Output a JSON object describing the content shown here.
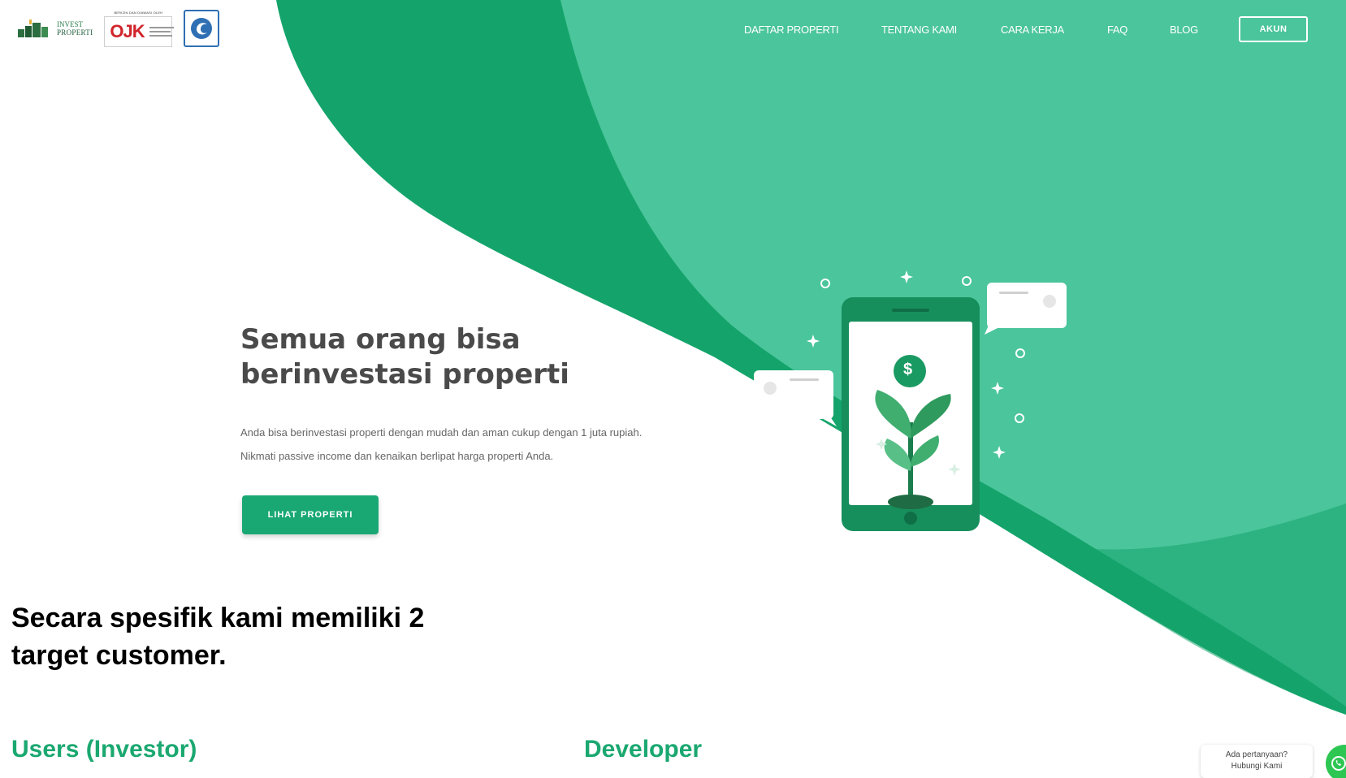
{
  "brand": {
    "logo_line1": "INVEST",
    "logo_line2": "PROPERTI",
    "ojk_caption": "BERIZIN DAN DIAWASI OLEH",
    "ojk_mark": "OJK"
  },
  "nav": {
    "items": [
      {
        "label": "DAFTAR PROPERTI"
      },
      {
        "label": "TENTANG KAMI"
      },
      {
        "label": "CARA KERJA"
      },
      {
        "label": "FAQ"
      },
      {
        "label": "BLOG"
      }
    ],
    "account_label": "AKUN"
  },
  "hero": {
    "title": "Semua orang bisa berinvestasi properti",
    "description": "Anda bisa berinvestasi properti dengan mudah dan aman cukup dengan 1 juta rupiah. Nikmati passive income dan kenaikan berlipat harga properti Anda.",
    "cta_label": "LIHAT PROPERTI",
    "coin_symbol": "$"
  },
  "section": {
    "title": "Secara spesifik kami memiliki 2 target customer.",
    "customers": [
      {
        "label": "Users (Investor)"
      },
      {
        "label": "Developer"
      }
    ]
  },
  "chat": {
    "line1": "Ada pertanyaan?",
    "line2": "Hubungi Kami"
  },
  "colors": {
    "green_dark": "#14a46b",
    "green_light": "#4bc59b",
    "accent_text": "#1aa870"
  },
  "icons": [
    "building-logo-icon",
    "ojk-icon",
    "kominfo-icon",
    "phone-plant-illustration",
    "whatsapp-icon"
  ]
}
